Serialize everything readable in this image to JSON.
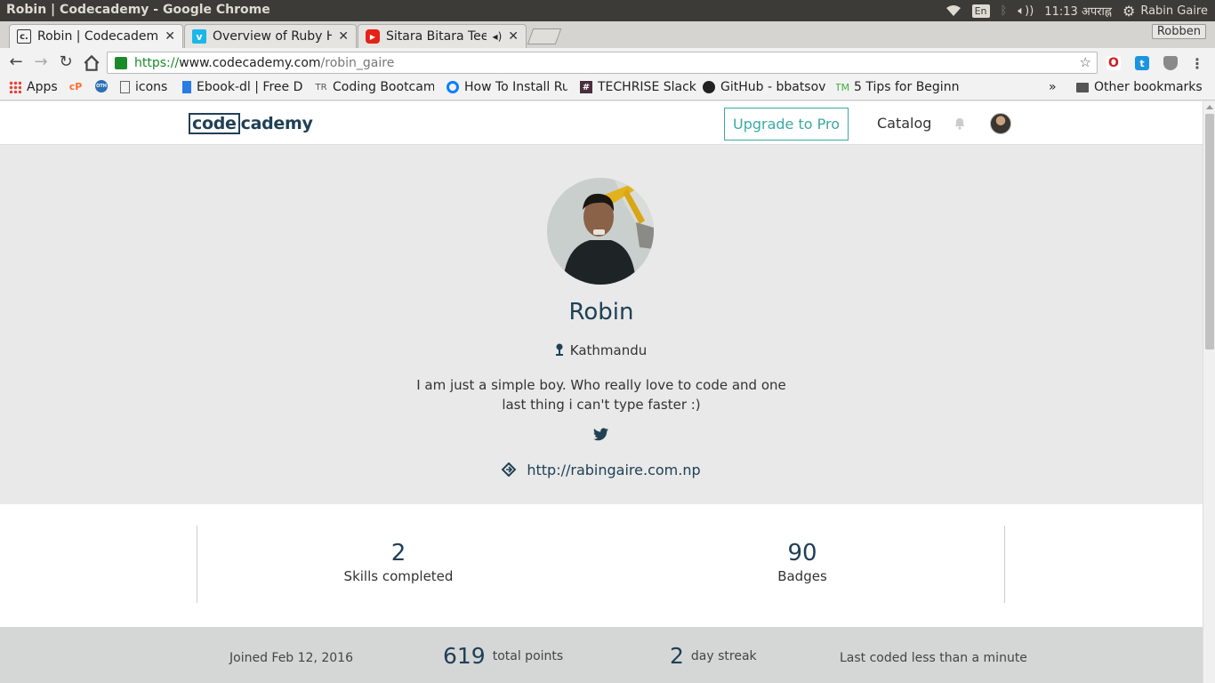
{
  "os": {
    "window_title": "Robin | Codecademy - Google Chrome",
    "lang": "En",
    "time": "11:13 अपराह्न",
    "user": "Rabin Gaire"
  },
  "tabs": [
    {
      "title": "Robin | Codecademy",
      "favicon": "c.",
      "active": true
    },
    {
      "title": "Overview of Ruby H",
      "favicon": "v",
      "active": false
    },
    {
      "title": "Sitara Bitara Teej",
      "favicon": "▶",
      "active": false
    }
  ],
  "profile_chip": "Robben",
  "omnibox": {
    "scheme": "https://",
    "host": "www.codecademy.com",
    "path": "/robin_gaire"
  },
  "bookmarks": [
    {
      "label": "Apps",
      "icon": "apps-grid-icon"
    },
    {
      "label": "",
      "icon": "cpanel-icon"
    },
    {
      "label": "",
      "icon": "oth-icon"
    },
    {
      "label": "icons",
      "icon": "page-icon"
    },
    {
      "label": "Ebook-dl | Free D",
      "icon": "bookmark-blue-icon"
    },
    {
      "label": "Coding Bootcam",
      "icon": "tr-icon"
    },
    {
      "label": "How To Install Ru",
      "icon": "digitalocean-icon"
    },
    {
      "label": "TECHRISE Slack",
      "icon": "hash-icon"
    },
    {
      "label": "GitHub - bbatsov",
      "icon": "github-icon"
    },
    {
      "label": "5 Tips for Beginn",
      "icon": "tm-icon"
    },
    {
      "label": "»",
      "icon": "chevron-more-icon"
    },
    {
      "label": "Other bookmarks",
      "icon": "folder-icon"
    }
  ],
  "site": {
    "logo_box": "code",
    "logo_rest": "cademy",
    "upgrade": "Upgrade to Pro",
    "catalog": "Catalog"
  },
  "profile": {
    "name": "Robin",
    "location": "Kathmandu",
    "bio": "I am just a simple boy. Who really love to code and one last thing i can't type faster :)",
    "website": "http://rabingaire.com.np"
  },
  "stats": [
    {
      "value": "2",
      "label": "Skills completed"
    },
    {
      "value": "90",
      "label": "Badges"
    }
  ],
  "meta": {
    "joined": "Joined Feb 12, 2016",
    "points_value": "619",
    "points_label": "total points",
    "streak_value": "2",
    "streak_label": "day streak",
    "last_coded": "Last coded less than a minute"
  },
  "colors": {
    "brand": "#204056",
    "accent": "#3ba9a3"
  }
}
